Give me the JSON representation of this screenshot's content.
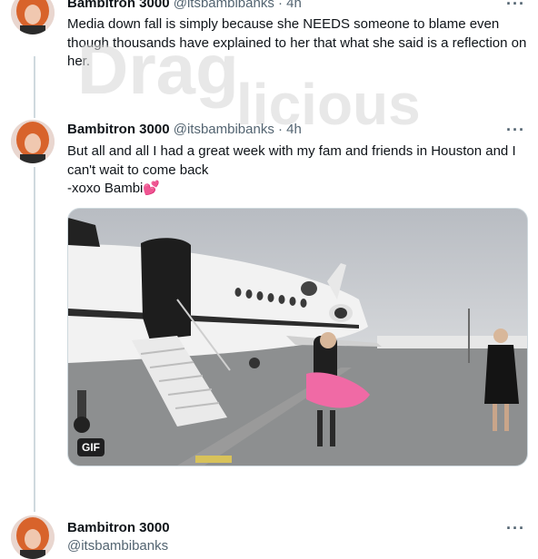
{
  "tweets": [
    {
      "name": "Bambitron 3000",
      "handle": "@itsbambibanks",
      "dot": "·",
      "time": "4h",
      "text": "Media down fall is simply because she NEEDS someone to blame even though thousands have explained to her that what she said is a reflection on her."
    },
    {
      "name": "Bambitron 3000",
      "handle": "@itsbambibanks",
      "dot": "·",
      "time": "4h",
      "text_line1": "But all and all I had a great week with my fam and friends in Houston and I can't wait to come back",
      "text_line2": "-xoxo Bambi💕",
      "media_badge": "GIF"
    },
    {
      "name": "Bambitron 3000",
      "handle": "@itsbambibanks"
    }
  ],
  "more_label": "···",
  "watermark": "Draglicious",
  "colors": {
    "thread_line": "#cfd9de",
    "secondary_text": "#536471",
    "primary_text": "#0f1419"
  }
}
